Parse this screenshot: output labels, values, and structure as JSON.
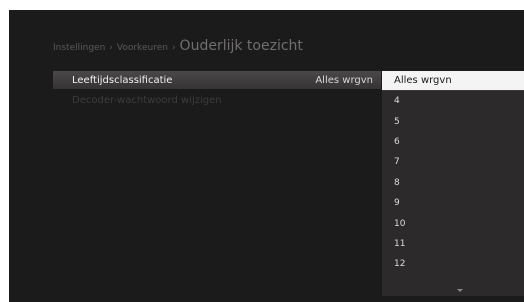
{
  "breadcrumb": {
    "level1": "Instellingen",
    "level2": "Voorkeuren",
    "current": "Ouderlijk toezicht",
    "separator": "›"
  },
  "menu": {
    "items": [
      {
        "label": "Leeftijdsclassificatie",
        "value": "Alles wrgvn"
      },
      {
        "label": "Decoder-wachtwoord wijzigen",
        "value": ""
      }
    ]
  },
  "dropdown": {
    "selected": "Alles wrgvn",
    "options": [
      "4",
      "5",
      "6",
      "7",
      "8",
      "9",
      "10",
      "11",
      "12"
    ]
  },
  "colors": {
    "screen_background": "#1c1b1b",
    "dropdown_background": "#2c2a2a",
    "selection_highlight": "#f4f4f4"
  }
}
